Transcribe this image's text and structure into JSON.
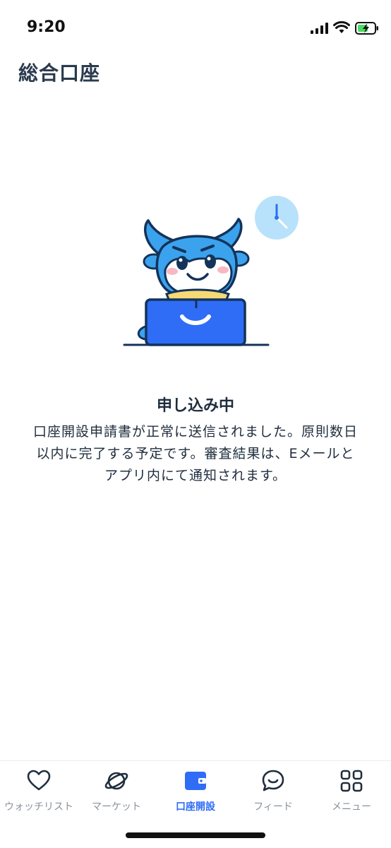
{
  "status_bar": {
    "time": "9:20"
  },
  "header": {
    "title": "総合口座"
  },
  "main": {
    "status_heading": "申し込み中",
    "status_message": "口座開設申請書が正常に送信されました。原則数日以内に完了する予定です。審査結果は、Eメールとアプリ内にて通知されます。"
  },
  "tab_bar": {
    "tabs": [
      {
        "label": "ウォッチリスト",
        "icon": "heart-icon"
      },
      {
        "label": "マーケット",
        "icon": "planet-icon"
      },
      {
        "label": "口座開設",
        "icon": "wallet-icon"
      },
      {
        "label": "フィード",
        "icon": "chat-bubble-icon"
      },
      {
        "label": "メニュー",
        "icon": "grid-menu-icon"
      }
    ],
    "active_index": 2
  },
  "colors": {
    "accent": "#2f6df6",
    "text": "#1f2d3d",
    "inactive": "#8a919c"
  }
}
